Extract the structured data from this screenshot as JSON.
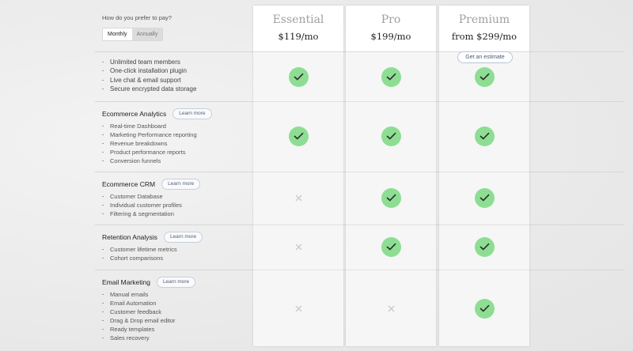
{
  "billing": {
    "question": "How do you prefer to pay?",
    "options": [
      "Monthly",
      "Annually"
    ],
    "selected": "Monthly"
  },
  "plans": [
    {
      "name": "Essential",
      "price": "$119/mo"
    },
    {
      "name": "Pro",
      "price": "$199/mo"
    },
    {
      "name": "Premium",
      "price": "from $299/mo",
      "action": "Get an estimate"
    }
  ],
  "base_features": [
    "Unlimited team members",
    "One-click installation plugin",
    "Live chat & email support",
    "Secure encrypted data storage"
  ],
  "learn_more_label": "Learn more",
  "modules": [
    {
      "title": "Ecommerce Analytics",
      "items": [
        "Real-time Dashboard",
        "Marketing Performance reporting",
        "Revenue breakdowns",
        "Product performance reports",
        "Conversion funnels"
      ]
    },
    {
      "title": "Ecommerce CRM",
      "items": [
        "Customer Database",
        "Individual customer profiles",
        "Filtering & segmentation"
      ]
    },
    {
      "title": "Retention Analysis",
      "items": [
        "Customer lifetime metrics",
        "Cohort comparisons"
      ]
    },
    {
      "title": "Email Marketing",
      "items": [
        "Manual emails",
        "Email Automation",
        "Customer feedback",
        "Drag & Drop email editor",
        "Ready templates",
        "Sales recovery"
      ]
    }
  ],
  "availability": {
    "Essential": [
      true,
      true,
      false,
      false,
      false
    ],
    "Pro": [
      true,
      true,
      true,
      true,
      false
    ],
    "Premium": [
      true,
      true,
      true,
      true,
      true
    ]
  },
  "colors": {
    "check": "#8dde93",
    "cross": "#c9c9c9",
    "card": "#f6f6f6"
  },
  "icons": {
    "included": "check-icon",
    "excluded": "cross-icon"
  }
}
